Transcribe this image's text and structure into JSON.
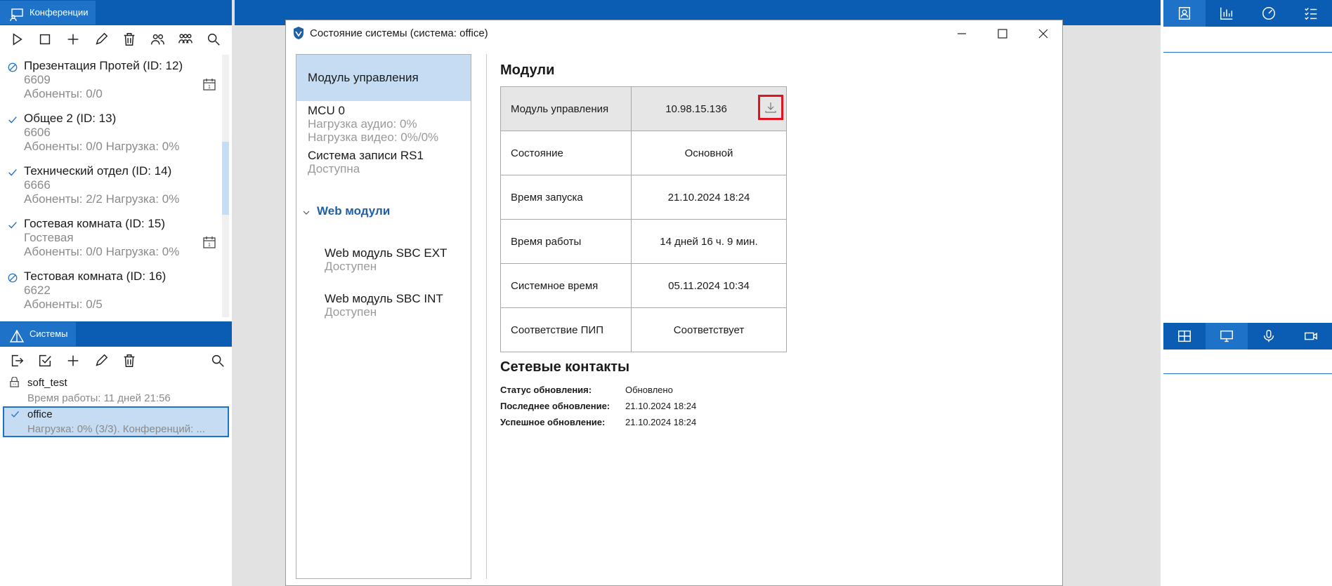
{
  "conferences_panel": {
    "tab_label": "Конференции",
    "items": [
      {
        "title": "Презентация Протей (ID: 12)",
        "number": "6609",
        "info": "Абоненты: 0/0",
        "status": "blocked",
        "scheduled": true
      },
      {
        "title": "Общее 2 (ID: 13)",
        "number": "6606",
        "info": "Абоненты: 0/0 Нагрузка: 0%",
        "status": "active",
        "scheduled": false
      },
      {
        "title": "Технический отдел (ID: 14)",
        "number": "6666",
        "info": "Абоненты: 2/2 Нагрузка: 0%",
        "status": "active",
        "scheduled": false
      },
      {
        "title": "Гостевая комната (ID: 15)",
        "number": "Гостевая",
        "info": "Абоненты: 0/0 Нагрузка: 0%",
        "status": "active",
        "scheduled": true
      },
      {
        "title": "Тестовая комната (ID: 16)",
        "number": "6622",
        "info": "Абоненты: 0/5",
        "status": "blocked",
        "scheduled": false
      }
    ],
    "toolbar_icons": [
      "play-icon",
      "stop-icon",
      "add-icon",
      "edit-icon",
      "delete-icon",
      "participants-icon",
      "groups-icon",
      "search-icon"
    ]
  },
  "systems_panel": {
    "tab_label": "Системы",
    "items": [
      {
        "name": "soft_test",
        "info": "Время работы: 11 дней 21:56",
        "selected": false
      },
      {
        "name": "office",
        "info": "Нагрузка: 0% (3/3). Конференций: ...",
        "selected": true
      }
    ]
  },
  "dialog": {
    "title": "Состояние системы (система: office)",
    "left_pane": {
      "selected": "Модуль управления",
      "mcu": {
        "name": "MCU 0",
        "audio": "Нагрузка аудио: 0%",
        "video": "Нагрузка видео: 0%/0%"
      },
      "recorder": {
        "name": "Система записи RS1",
        "status": "Доступна"
      },
      "web_group": "Web модули",
      "web_modules": [
        {
          "name": "Web модуль SBC EXT",
          "status": "Доступен"
        },
        {
          "name": "Web модуль SBC INT",
          "status": "Доступен"
        }
      ]
    },
    "modules_heading": "Модули",
    "modules_table": [
      {
        "key": "Модуль управления",
        "value": "10.98.15.136"
      },
      {
        "key": "Состояние",
        "value": "Основной"
      },
      {
        "key": "Время запуска",
        "value": "21.10.2024 18:24"
      },
      {
        "key": "Время работы",
        "value": "14 дней 16 ч. 9 мин."
      },
      {
        "key": "Системное время",
        "value": "05.11.2024 10:34"
      },
      {
        "key": "Соответствие ПИП",
        "value": "Соответствует"
      }
    ],
    "network_heading": "Сетевые контакты",
    "network": [
      {
        "key": "Статус обновления:",
        "value": "Обновлено"
      },
      {
        "key": "Последнее обновление:",
        "value": "21.10.2024 18:24"
      },
      {
        "key": "Успешное обновление:",
        "value": "21.10.2024 18:24"
      }
    ]
  },
  "colors": {
    "brand": "#0a5db3",
    "accent": "#1e73c8",
    "selection": "#c5dcf2",
    "highlight": "#e0141e"
  }
}
